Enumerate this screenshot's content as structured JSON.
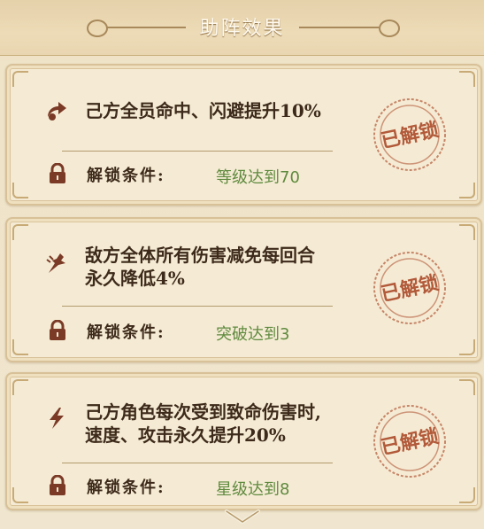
{
  "header": {
    "title": "助阵效果"
  },
  "cards": [
    {
      "effect_icon": "aim-arrow-icon",
      "effect": "己方全员命中、闪避提升10%",
      "condition_label": "解锁条件:",
      "condition_value": "等级达到70",
      "stamp": "已解锁"
    },
    {
      "effect_icon": "broken-sword-icon",
      "effect_line1": "敌方全体所有伤害减免每回合",
      "effect_line2": "永久降低4%",
      "condition_label": "解锁条件:",
      "condition_value": "突破达到3",
      "stamp": "已解锁"
    },
    {
      "effect_icon": "lightning-icon",
      "effect_line1": "己方角色每次受到致命伤害时,",
      "effect_line2": "速度、攻击永久提升20%",
      "condition_label": "解锁条件:",
      "condition_value": "星级达到8",
      "stamp": "已解锁"
    }
  ],
  "footer": {
    "scroll_icon": "chevron-down-icon"
  },
  "colors": {
    "stamp": "#b25a3a",
    "condition_value": "#5f8a3e",
    "text": "#3d2a1a"
  }
}
